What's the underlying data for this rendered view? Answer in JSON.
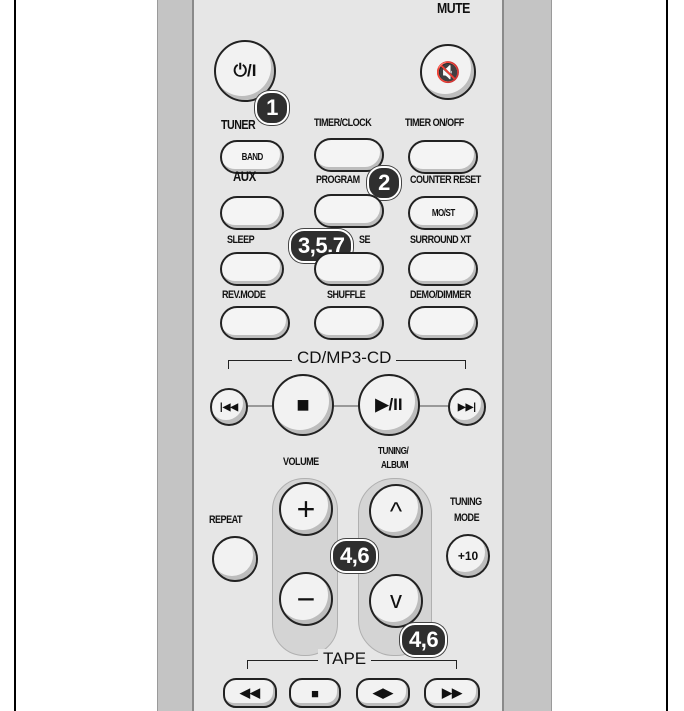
{
  "top": {
    "mute_label": "MUTE",
    "power_glyph": "⏻/I",
    "mute_glyph": "🔇"
  },
  "labels": {
    "tuner": "TUNER",
    "timer_clock": "TIMER/CLOCK",
    "timer_onoff": "TIMER ON/OFF",
    "aux": "AUX",
    "program": "PROGRAM",
    "counter_reset": "COUNTER RESET",
    "sleep": "SLEEP",
    "pause_partial": "SE",
    "surround": "SURROUND XT",
    "rev_mode": "REV.MODE",
    "shuffle": "SHUFFLE",
    "demo_dimmer": "DEMO/DIMMER",
    "volume": "VOLUME",
    "tuning_album_1": "TUNING/",
    "tuning_album_2": "ALBUM",
    "repeat": "REPEAT",
    "tuning_mode_1": "TUNING",
    "tuning_mode_2": "MODE"
  },
  "buttons": {
    "band": "BAND",
    "mo_st": "MO/ST",
    "plus10": "+10"
  },
  "sections": {
    "cd": "CD/MP3-CD",
    "tape": "TAPE"
  },
  "callouts": {
    "c1": "1",
    "c2": "2",
    "c357": "3,5,7",
    "c46a": "4,6",
    "c46b": "4,6"
  },
  "glyphs": {
    "prev": "|◀◀",
    "stop": "■",
    "play_pause": "▶/II",
    "next": "▶▶|",
    "plus": "+",
    "minus": "−",
    "up": "^",
    "down": "v",
    "rew": "◀◀",
    "tape_stop": "■",
    "reverse": "◀▶",
    "ff": "▶▶"
  }
}
